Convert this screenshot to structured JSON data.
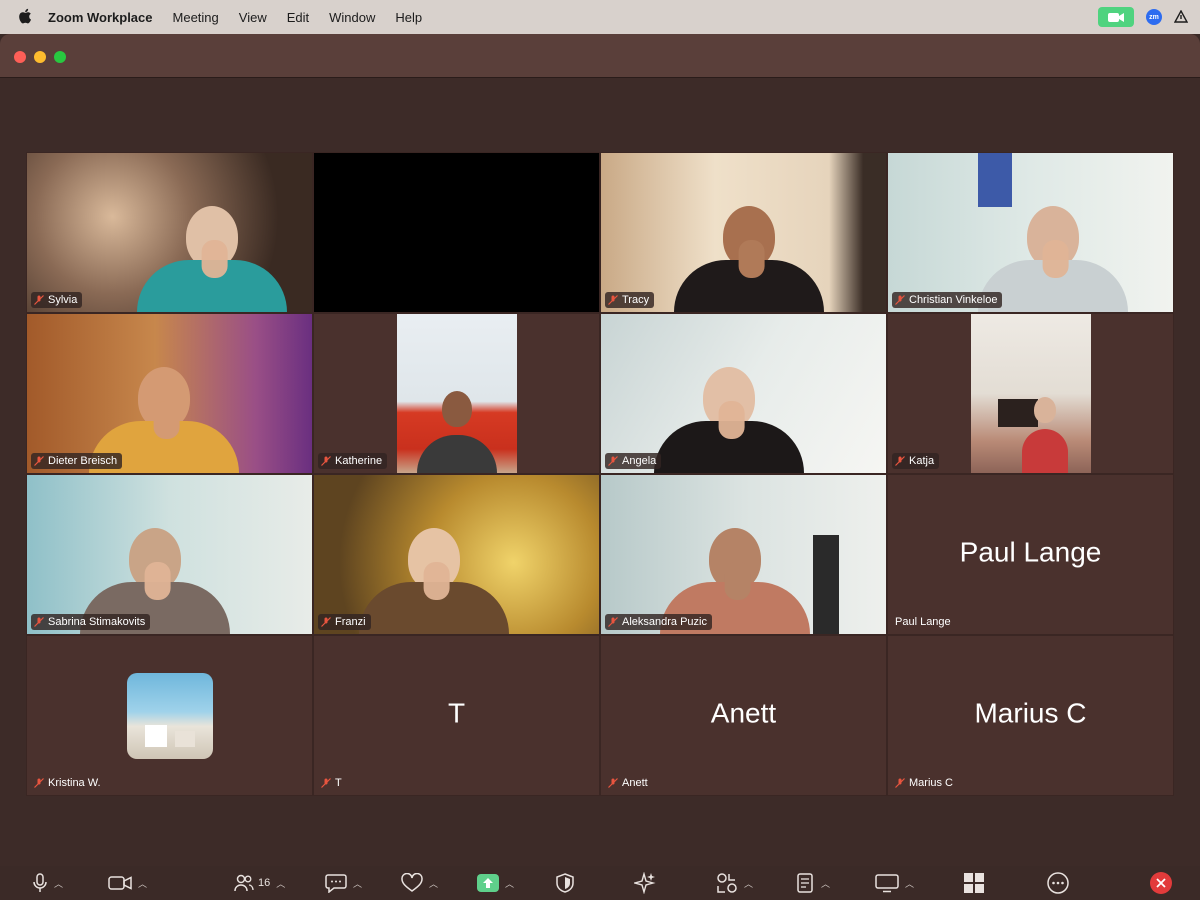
{
  "menubar": {
    "app_name": "Zoom Workplace",
    "items": [
      "Meeting",
      "View",
      "Edit",
      "Window",
      "Help"
    ],
    "zoom_badge": "zm"
  },
  "participants": [
    {
      "name": "Sylvia",
      "muted": true
    },
    {
      "name": "",
      "muted": false
    },
    {
      "name": "Tracy",
      "muted": true
    },
    {
      "name": "Christian Vinkeloe",
      "muted": true
    },
    {
      "name": "Dieter Breisch",
      "muted": true
    },
    {
      "name": "Katherine",
      "muted": true
    },
    {
      "name": "Angela",
      "muted": true
    },
    {
      "name": "Katja",
      "muted": true
    },
    {
      "name": "Sabrina Stimakovits",
      "muted": true
    },
    {
      "name": "Franzi",
      "muted": true
    },
    {
      "name": "Aleksandra Puzic",
      "muted": true
    },
    {
      "name": "Paul Lange",
      "muted": false,
      "big_label": "Paul Lange"
    },
    {
      "name": "Kristina W.",
      "muted": true
    },
    {
      "name": "T",
      "muted": true,
      "big_label": "T"
    },
    {
      "name": "Anett",
      "muted": true,
      "big_label": "Anett"
    },
    {
      "name": "Marius C",
      "muted": true,
      "big_label": "Marius C"
    }
  ],
  "toolbar": {
    "participants_count": "16"
  },
  "colors": {
    "window_bg": "#3d2b28",
    "tile_bg": "#4a312d",
    "share_green": "#5fd08b",
    "end_red": "#e23b3b",
    "mute_red": "#e8553f"
  }
}
